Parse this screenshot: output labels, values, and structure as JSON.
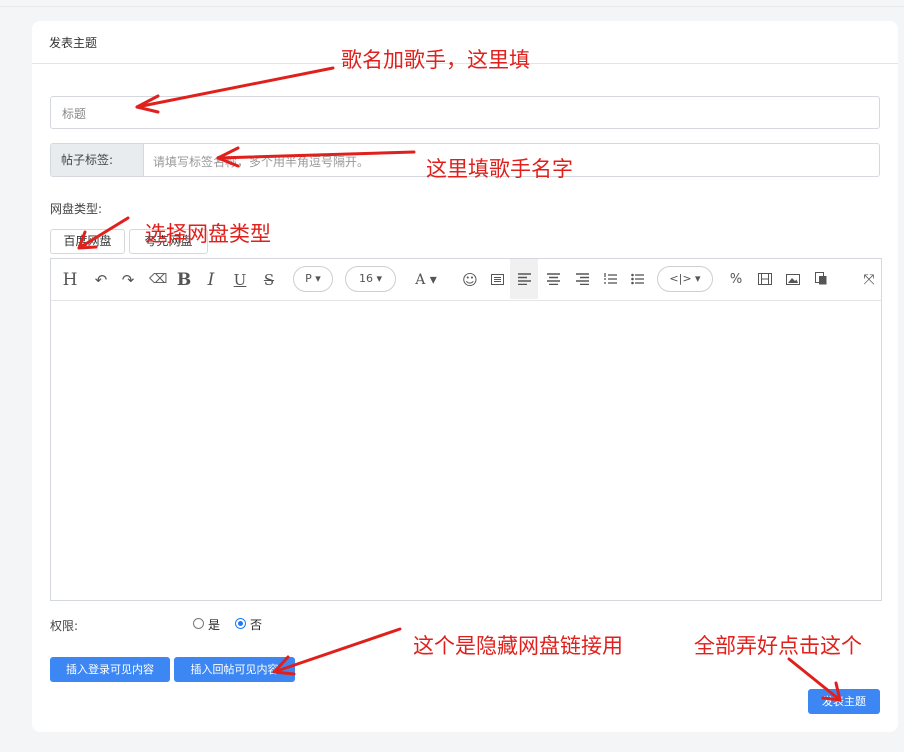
{
  "card": {
    "title": "发表主题",
    "title_input": {
      "placeholder": "标题"
    },
    "tags": {
      "label": "帖子标签:",
      "placeholder": "请填写标签名称，多个用半角逗号隔开。"
    },
    "disk_type": {
      "label": "网盘类型:",
      "options": [
        "百度网盘",
        "夸克网盘"
      ]
    },
    "toolbar": {
      "heading": "H",
      "undo": "↶",
      "redo": "↷",
      "eraser": "⌫",
      "bold": "B",
      "italic": "I",
      "underline": "U",
      "strike": "S",
      "paragraph": "P ▾",
      "font_size": "16 ▾",
      "font_color": "A ▾",
      "emoji": "☺",
      "code": "<|> ▾",
      "link": "%",
      "fullscreen": "⤧"
    },
    "permission": {
      "label": "权限:",
      "options": [
        "是",
        "否"
      ],
      "selected": "否"
    },
    "buttons": {
      "insert_login": "插入登录可见内容",
      "insert_reply": "插入回帖可见内容"
    },
    "submit": "发表主题"
  },
  "annotations": {
    "title_note": "歌名加歌手，这里填",
    "tag_note": "这里填歌手名字",
    "disk_note": "选择网盘类型",
    "hidden_note": "这个是隐藏网盘链接用",
    "submit_note": "全部弄好点击这个"
  },
  "colors": {
    "accent": "#3d87f5",
    "annotation": "#e0201c"
  }
}
